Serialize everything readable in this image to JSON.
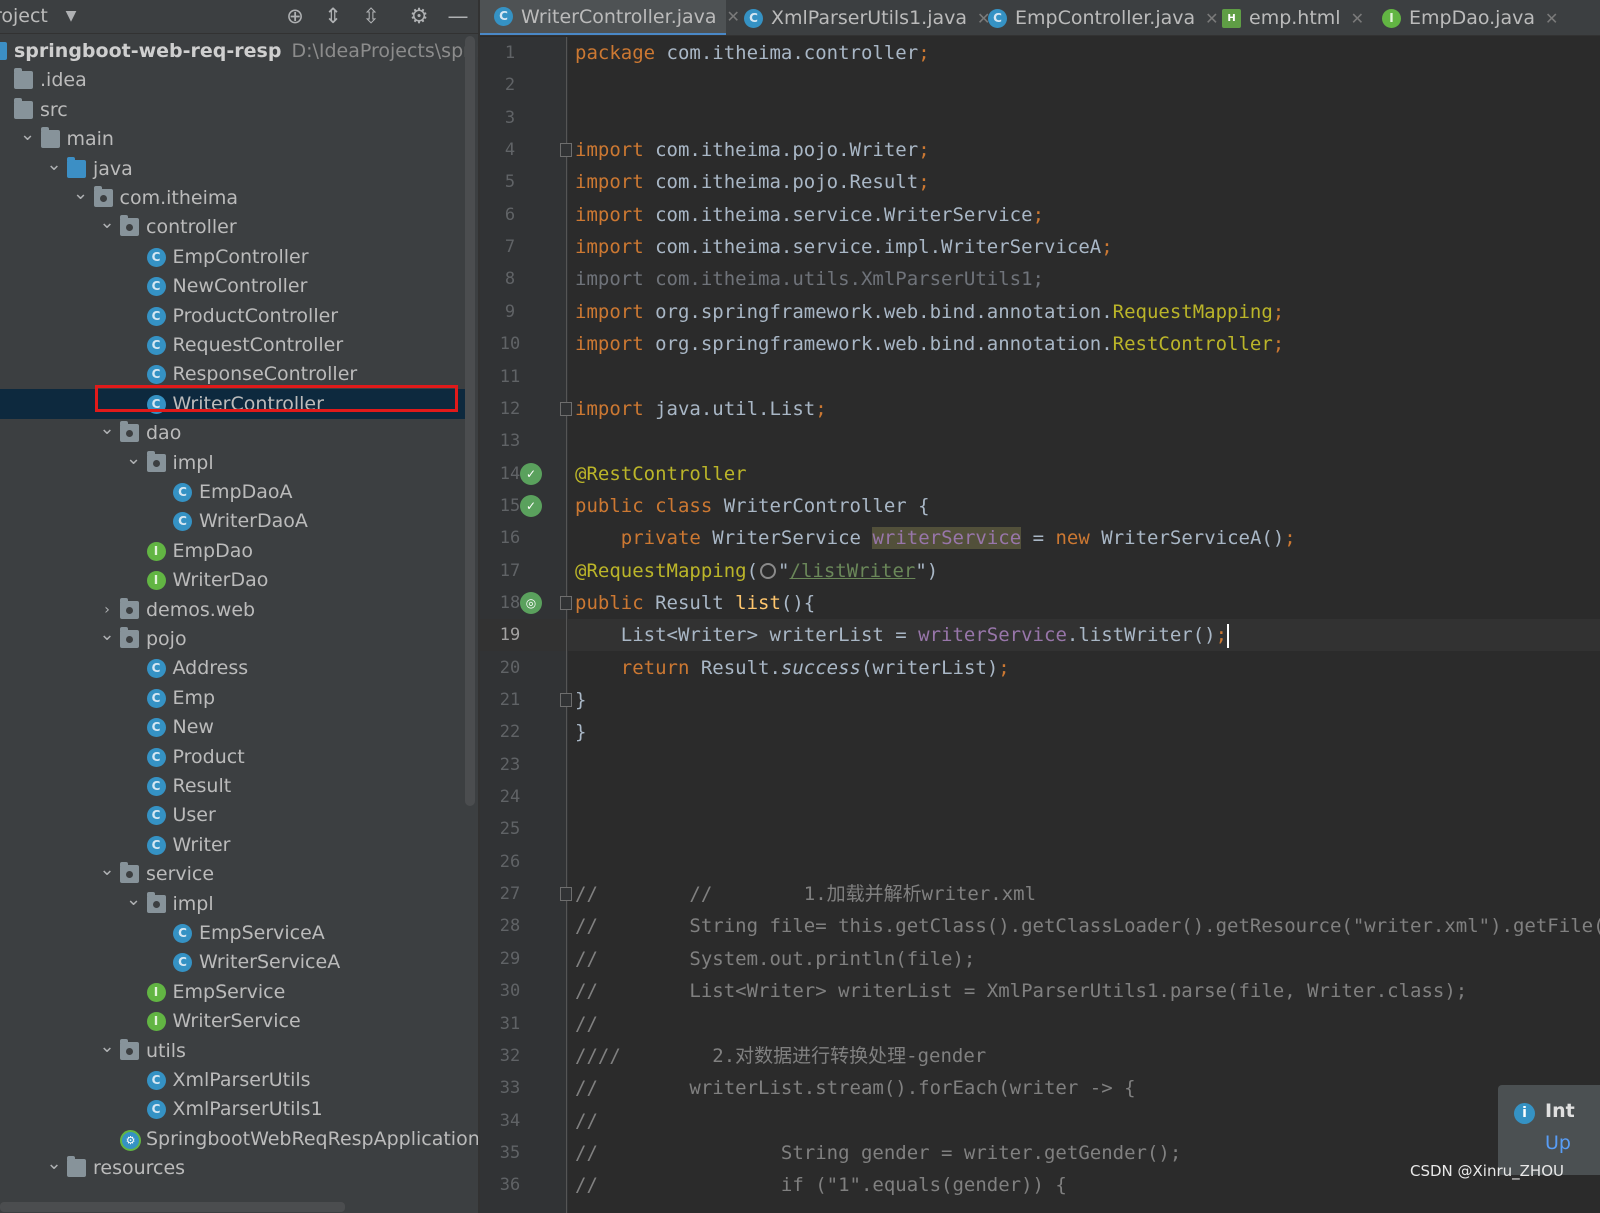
{
  "project_panel": {
    "title": "roject",
    "header_icons": [
      "locate-icon",
      "expand-all-icon",
      "collapse-all-icon",
      "gear-icon",
      "minimize-icon"
    ],
    "tree": [
      {
        "label": "springboot-web-req-resp",
        "path": "D:\\IdeaProjects\\springboot",
        "icon": "module-icon",
        "chevron": ""
      },
      {
        "label": ".idea",
        "icon": "folder-icon",
        "chevron": ""
      },
      {
        "label": "src",
        "icon": "folder-icon",
        "chevron": ""
      },
      {
        "label": "main",
        "icon": "folder-icon",
        "chevron": "expanded"
      },
      {
        "label": "java",
        "icon": "source-folder-icon",
        "chevron": "expanded"
      },
      {
        "label": "com.itheima",
        "icon": "package-icon",
        "chevron": "expanded"
      },
      {
        "label": "controller",
        "icon": "package-icon",
        "chevron": "expanded"
      },
      {
        "label": "EmpController",
        "icon": "class-icon",
        "chevron": ""
      },
      {
        "label": "NewController",
        "icon": "class-icon",
        "chevron": ""
      },
      {
        "label": "ProductController",
        "icon": "class-icon",
        "chevron": ""
      },
      {
        "label": "RequestController",
        "icon": "class-icon",
        "chevron": ""
      },
      {
        "label": "ResponseController",
        "icon": "class-icon",
        "chevron": ""
      },
      {
        "label": "WriterController",
        "icon": "class-icon",
        "chevron": "",
        "selected": true
      },
      {
        "label": "dao",
        "icon": "package-icon",
        "chevron": "expanded"
      },
      {
        "label": "impl",
        "icon": "package-icon",
        "chevron": "expanded"
      },
      {
        "label": "EmpDaoA",
        "icon": "class-icon",
        "chevron": ""
      },
      {
        "label": "WriterDaoA",
        "icon": "class-icon",
        "chevron": ""
      },
      {
        "label": "EmpDao",
        "icon": "interface-icon",
        "chevron": ""
      },
      {
        "label": "WriterDao",
        "icon": "interface-icon",
        "chevron": ""
      },
      {
        "label": "demos.web",
        "icon": "package-icon",
        "chevron": "collapsed"
      },
      {
        "label": "pojo",
        "icon": "package-icon",
        "chevron": "expanded"
      },
      {
        "label": "Address",
        "icon": "class-icon",
        "chevron": ""
      },
      {
        "label": "Emp",
        "icon": "class-icon",
        "chevron": ""
      },
      {
        "label": "New",
        "icon": "class-icon",
        "chevron": ""
      },
      {
        "label": "Product",
        "icon": "class-icon",
        "chevron": ""
      },
      {
        "label": "Result",
        "icon": "class-icon",
        "chevron": ""
      },
      {
        "label": "User",
        "icon": "class-icon",
        "chevron": ""
      },
      {
        "label": "Writer",
        "icon": "class-icon",
        "chevron": ""
      },
      {
        "label": "service",
        "icon": "package-icon",
        "chevron": "expanded"
      },
      {
        "label": "impl",
        "icon": "package-icon",
        "chevron": "expanded"
      },
      {
        "label": "EmpServiceA",
        "icon": "class-icon",
        "chevron": ""
      },
      {
        "label": "WriterServiceA",
        "icon": "class-icon",
        "chevron": ""
      },
      {
        "label": "EmpService",
        "icon": "interface-icon",
        "chevron": ""
      },
      {
        "label": "WriterService",
        "icon": "interface-icon",
        "chevron": ""
      },
      {
        "label": "utils",
        "icon": "package-icon",
        "chevron": "expanded"
      },
      {
        "label": "XmlParserUtils",
        "icon": "class-icon",
        "chevron": ""
      },
      {
        "label": "XmlParserUtils1",
        "icon": "class-icon",
        "chevron": ""
      },
      {
        "label": "SpringbootWebReqRespApplication",
        "icon": "spring-app-icon",
        "chevron": ""
      },
      {
        "label": "resources",
        "icon": "resources-folder-icon",
        "chevron": "expanded"
      }
    ]
  },
  "tabs": [
    {
      "label": "WriterController.java",
      "icon": "class-icon",
      "active": true
    },
    {
      "label": "XmlParserUtils1.java",
      "icon": "class-icon",
      "active": false
    },
    {
      "label": "EmpController.java",
      "icon": "class-icon",
      "active": false
    },
    {
      "label": "emp.html",
      "icon": "html-file-icon",
      "active": false
    },
    {
      "label": "EmpDao.java",
      "icon": "interface-icon",
      "active": false
    }
  ],
  "editor": {
    "current_line": 19,
    "lines": [
      [
        {
          "t": "package ",
          "c": "kw"
        },
        {
          "t": "com.itheima.controller"
        },
        {
          "t": ";",
          "c": "kw"
        }
      ],
      [],
      [],
      [
        {
          "t": "import ",
          "c": "kw"
        },
        {
          "t": "com.itheima.pojo.Writer"
        },
        {
          "t": ";",
          "c": "kw"
        }
      ],
      [
        {
          "t": "import ",
          "c": "kw"
        },
        {
          "t": "com.itheima.pojo.Result"
        },
        {
          "t": ";",
          "c": "kw"
        }
      ],
      [
        {
          "t": "import ",
          "c": "kw"
        },
        {
          "t": "com.itheima.service.WriterService"
        },
        {
          "t": ";",
          "c": "kw"
        }
      ],
      [
        {
          "t": "import ",
          "c": "kw"
        },
        {
          "t": "com.itheima.service.impl.WriterServiceA"
        },
        {
          "t": ";",
          "c": "kw"
        }
      ],
      [
        {
          "t": "import com.itheima.utils.XmlParserUtils1;",
          "c": "dim"
        }
      ],
      [
        {
          "t": "import ",
          "c": "kw"
        },
        {
          "t": "org.springframework.web.bind.annotation."
        },
        {
          "t": "RequestMapping",
          "c": "ann"
        },
        {
          "t": ";",
          "c": "kw"
        }
      ],
      [
        {
          "t": "import ",
          "c": "kw"
        },
        {
          "t": "org.springframework.web.bind.annotation."
        },
        {
          "t": "RestController",
          "c": "ann"
        },
        {
          "t": ";",
          "c": "kw"
        }
      ],
      [],
      [
        {
          "t": "import ",
          "c": "kw"
        },
        {
          "t": "java.util.List"
        },
        {
          "t": ";",
          "c": "kw"
        }
      ],
      [],
      [
        {
          "t": "@RestController",
          "c": "ann"
        }
      ],
      [
        {
          "t": "public class ",
          "c": "kw"
        },
        {
          "t": "WriterController {"
        }
      ],
      [
        {
          "t": "    private ",
          "c": "kw"
        },
        {
          "t": "WriterService "
        },
        {
          "t": "writerService",
          "c": "fld-hl"
        },
        {
          "t": " = "
        },
        {
          "t": "new ",
          "c": "kw"
        },
        {
          "t": "WriterServiceA()"
        },
        {
          "t": ";",
          "c": "kw"
        }
      ],
      [
        {
          "t": "@RequestMapping",
          "c": "ann"
        },
        {
          "t": "("
        },
        {
          "t": "",
          "c": "globe"
        },
        {
          "t": "\""
        },
        {
          "t": "/listWriter",
          "c": "str"
        },
        {
          "t": "\")"
        }
      ],
      [
        {
          "t": "public ",
          "c": "kw"
        },
        {
          "t": "Result "
        },
        {
          "t": "list",
          "c": "fn"
        },
        {
          "t": "(){"
        }
      ],
      [
        {
          "t": "    List<Writer> writerList = "
        },
        {
          "t": "writerService",
          "c": "fld"
        },
        {
          "t": ".listWriter()"
        },
        {
          "t": ";",
          "c": "kw"
        },
        {
          "t": "",
          "c": "caret"
        }
      ],
      [
        {
          "t": "    return ",
          "c": "kw"
        },
        {
          "t": "Result."
        },
        {
          "t": "success",
          "c": "ital"
        },
        {
          "t": "(writerList)"
        },
        {
          "t": ";",
          "c": "kw"
        }
      ],
      [
        {
          "t": "}"
        }
      ],
      [
        {
          "t": "}"
        }
      ],
      [],
      [],
      [],
      [],
      [
        {
          "t": "//        //        1.加载并解析writer.xml",
          "c": "cmt"
        }
      ],
      [
        {
          "t": "//        String file= this.getClass().getClassLoader().getResource(\"writer.xml\").getFile();",
          "c": "cmt"
        }
      ],
      [
        {
          "t": "//        System.out.println(file);",
          "c": "cmt"
        }
      ],
      [
        {
          "t": "//        List<Writer> writerList = XmlParserUtils1.parse(file, Writer.class);",
          "c": "cmt"
        }
      ],
      [
        {
          "t": "//",
          "c": "cmt"
        }
      ],
      [
        {
          "t": "////        2.对数据进行转换处理-gender",
          "c": "cmt"
        }
      ],
      [
        {
          "t": "//        writerList.stream().forEach(writer -> {",
          "c": "cmt"
        }
      ],
      [
        {
          "t": "//",
          "c": "cmt"
        }
      ],
      [
        {
          "t": "//                String gender = writer.getGender();",
          "c": "cmt"
        }
      ],
      [
        {
          "t": "//                if (\"1\".equals(gender)) {",
          "c": "cmt"
        }
      ]
    ],
    "gutter_marks": [
      {
        "line": 14,
        "icon": "spring-bean-icon"
      },
      {
        "line": 15,
        "icon": "spring-bean-icon"
      },
      {
        "line": 18,
        "icon": "web-endpoint-icon"
      }
    ],
    "fold_marks": [
      4,
      12,
      18,
      21,
      27
    ]
  },
  "notification": {
    "title": "Int",
    "link": "Up",
    "icon": "info-icon"
  },
  "watermark": "CSDN @Xinru_ZHOU",
  "colors": {
    "keyword": "#cc7832",
    "annotation": "#bbb529",
    "comment": "#808080",
    "field": "#9876aa",
    "selection_box": "#e01a1a",
    "selected_row": "#0d293e"
  }
}
